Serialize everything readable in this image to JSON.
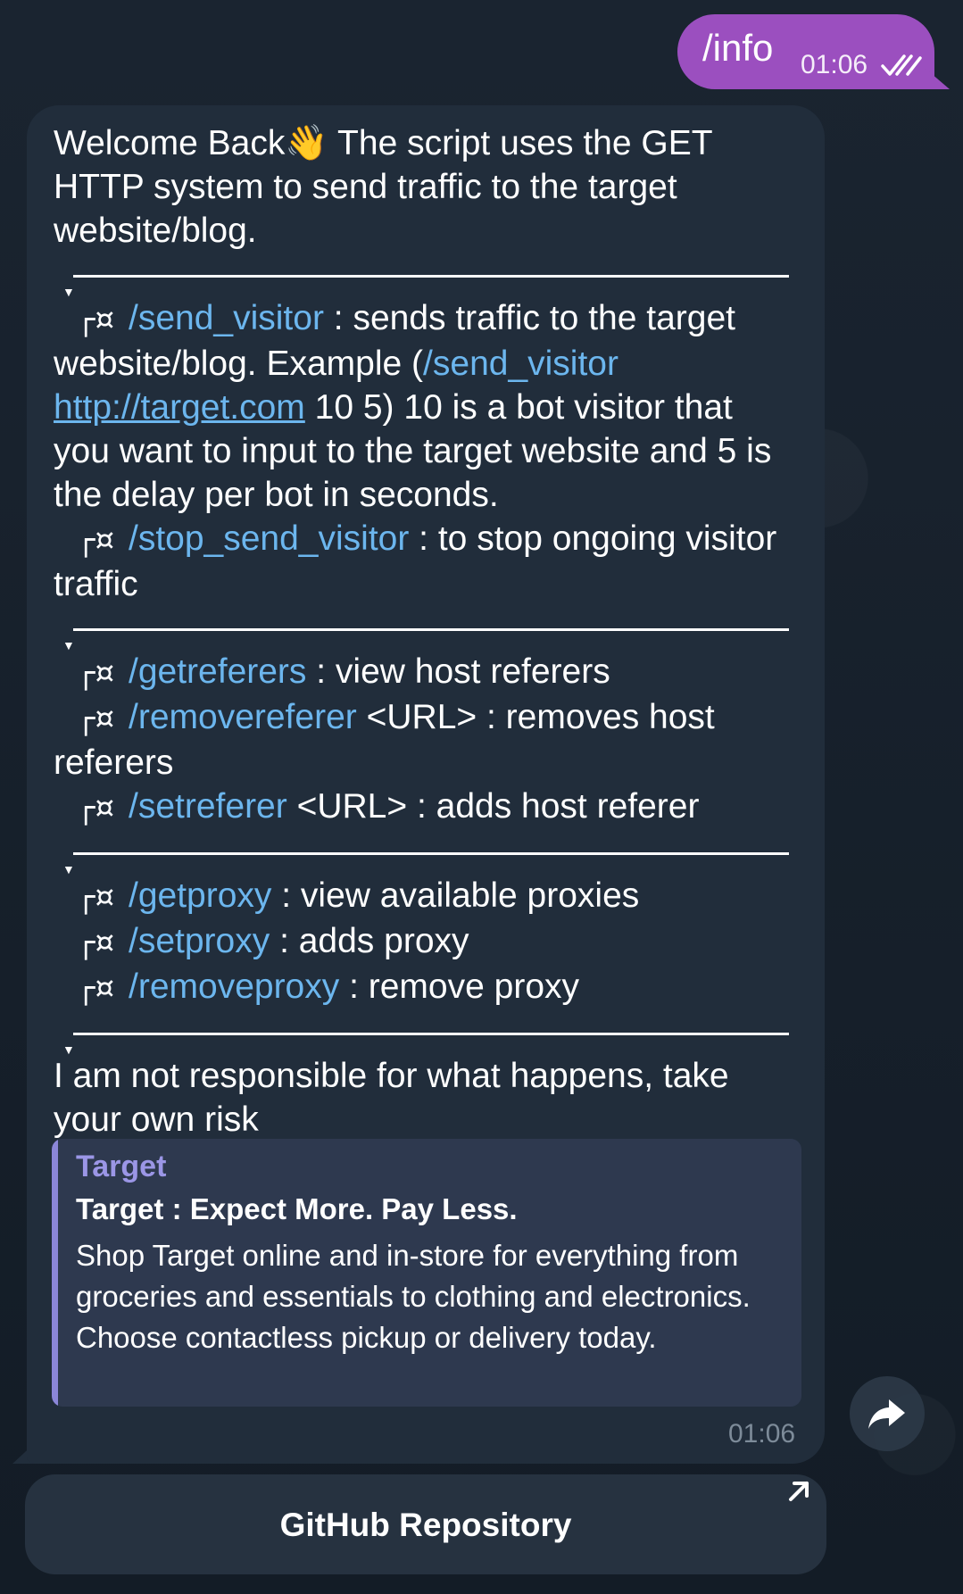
{
  "outgoing": {
    "text": "/info",
    "time": "01:06"
  },
  "incoming": {
    "intro": "Welcome Back👋 The script uses the GET HTTP system to send traffic to the target website/blog.",
    "bullet": "┌¤",
    "send_visitor": {
      "cmd": "/send_visitor",
      "desc_a": " : sends traffic to the target website/blog. Example (",
      "example_cmd": "/send_visitor",
      "example_space": " ",
      "example_url": "http://target.com",
      "desc_b": " 10 5) 10 is a bot visitor that you want to input to the target website and 5 is the delay per bot in seconds."
    },
    "stop_send_visitor": {
      "cmd": "/stop_send_visitor",
      "desc": " : to stop ongoing visitor traffic"
    },
    "getreferers": {
      "cmd": "/getreferers",
      "desc": " : view host referers"
    },
    "removereferer": {
      "cmd": "/removereferer",
      "desc": " <URL> : removes host referers"
    },
    "setreferer": {
      "cmd": "/setreferer",
      "desc": " <URL> : adds host referer"
    },
    "getproxy": {
      "cmd": "/getproxy",
      "desc": " : view available proxies"
    },
    "setproxy": {
      "cmd": "/setproxy",
      "desc": " : adds proxy"
    },
    "removeproxy": {
      "cmd": "/removeproxy",
      "desc": " : remove proxy"
    },
    "disclaimer": "I am not responsible for what happens, take your own risk",
    "time": "01:06"
  },
  "preview": {
    "site": "Target",
    "title": "Target : Expect More. Pay Less.",
    "description": "Shop Target online and in-store for everything from groceries and essentials to clothing and electronics. Choose contactless pickup or delivery today."
  },
  "inline_button": {
    "label": "GitHub Repository",
    "icon": "external-link-arrow-icon"
  },
  "share": {
    "icon": "share-forward-icon"
  },
  "colors": {
    "outgoing": "#9b4fbf",
    "incoming": "#212d3b",
    "command": "#6cb6ee",
    "preview_accent": "#8b86d8"
  }
}
